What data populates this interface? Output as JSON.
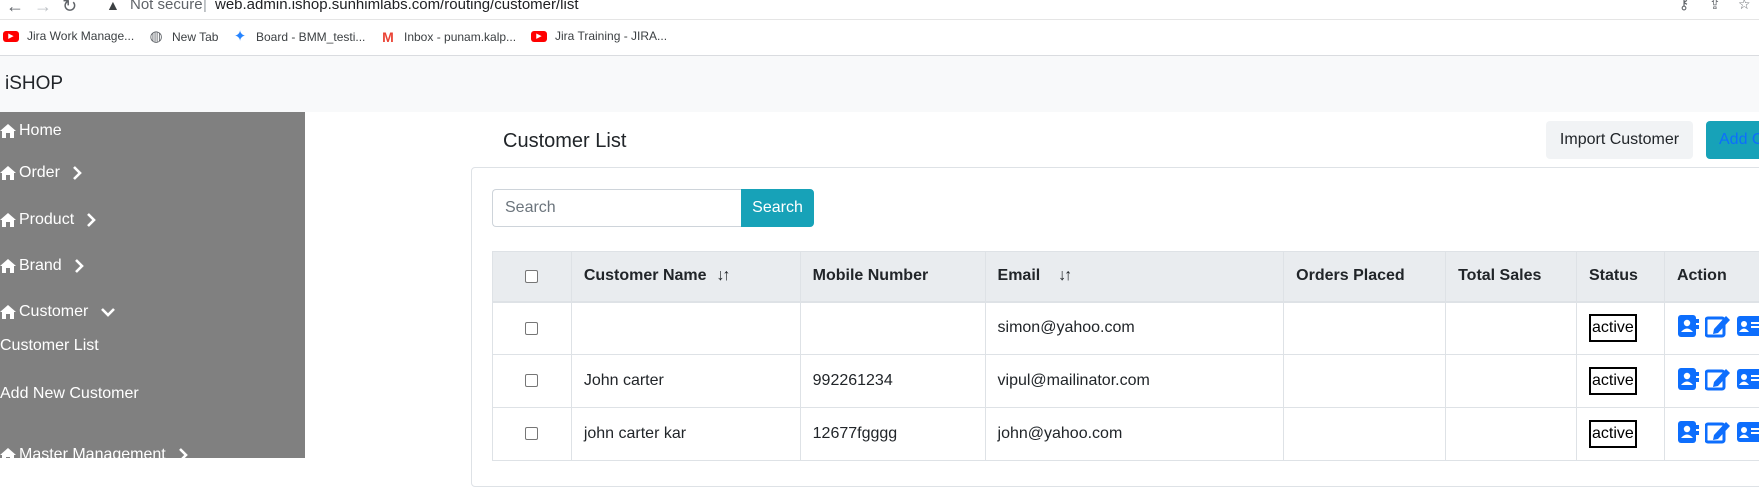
{
  "browser": {
    "security_label": "Not secure",
    "url": "web.admin.ishop.sunhimlabs.com/routing/customer/list",
    "bookmarks": [
      {
        "label": "Jira Work Manage...",
        "icon": "youtube-icon"
      },
      {
        "label": "New Tab",
        "icon": "globe-icon"
      },
      {
        "label": "Board - BMM_testi...",
        "icon": "jira-icon"
      },
      {
        "label": "Inbox - punam.kalp...",
        "icon": "gmail-icon"
      },
      {
        "label": "Jira Training - JIRA...",
        "icon": "youtube-icon"
      }
    ]
  },
  "app": {
    "brand": "iSHOP"
  },
  "sidebar": {
    "items": [
      {
        "label": "Home",
        "icon": "home-icon"
      },
      {
        "label": "Order",
        "icon": "home-icon",
        "chevron": "right"
      },
      {
        "label": "Product",
        "icon": "home-icon",
        "chevron": "right"
      },
      {
        "label": "Brand",
        "icon": "home-icon",
        "chevron": "right"
      },
      {
        "label": "Customer",
        "icon": "home-icon",
        "chevron": "down"
      },
      {
        "label": "Master Management",
        "icon": "home-icon",
        "chevron": "right"
      }
    ],
    "customer_sub": [
      "Customer List",
      "Add New Customer"
    ]
  },
  "main": {
    "title": "Customer List",
    "import_button": "Import Customer",
    "add_button": "Add C",
    "search_placeholder": "Search",
    "search_button": "Search",
    "table": {
      "columns": [
        "Customer Name",
        "Mobile Number",
        "Email",
        "Orders Placed",
        "Total Sales",
        "Status",
        "Action"
      ],
      "sort_glyph": "↓↑",
      "rows": [
        {
          "name": "",
          "mobile": "",
          "email": "simon@yahoo.com",
          "orders": "",
          "sales": "",
          "status": "active"
        },
        {
          "name": "John carter",
          "mobile": "992261234",
          "email": "vipul@mailinator.com",
          "orders": "",
          "sales": "",
          "status": "active"
        },
        {
          "name": "john carter kar",
          "mobile": "12677fgggg",
          "email": "john@yahoo.com",
          "orders": "",
          "sales": "",
          "status": "active"
        }
      ]
    }
  },
  "colors": {
    "sidebar_bg": "#808080",
    "accent": "#17a2b8",
    "action_icon": "#0d6efd"
  }
}
